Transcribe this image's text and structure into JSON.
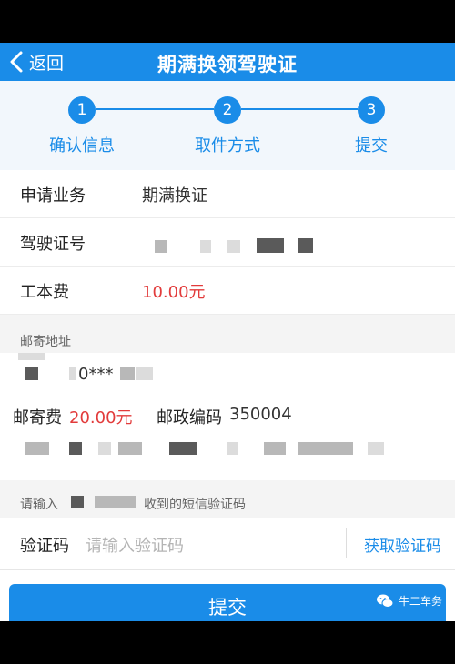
{
  "nav": {
    "back_label": "返回",
    "title": "期满换领驾驶证"
  },
  "steps": [
    {
      "num": "1",
      "label": "确认信息"
    },
    {
      "num": "2",
      "label": "取件方式"
    },
    {
      "num": "3",
      "label": "提交"
    }
  ],
  "info": {
    "business_label": "申请业务",
    "business_value": "期满换证",
    "license_label": "驾驶证号",
    "fee_label": "工本费",
    "fee_value": "10.00元"
  },
  "mail": {
    "section_label": "邮寄地址",
    "phone_partial": "0***",
    "postage_label": "邮寄费",
    "postage_value": "20.00元",
    "postcode_label": "邮政编码",
    "postcode_value": "350004"
  },
  "sms": {
    "hint_prefix": "请输入",
    "hint_suffix": "收到的短信验证码",
    "code_label": "验证码",
    "code_placeholder": "请输入验证码",
    "get_code_label": "获取验证码"
  },
  "submit_label": "提交",
  "watermark": "牛二车务",
  "colors": {
    "accent": "#1a8ce8",
    "price_red": "#e23b3b"
  }
}
